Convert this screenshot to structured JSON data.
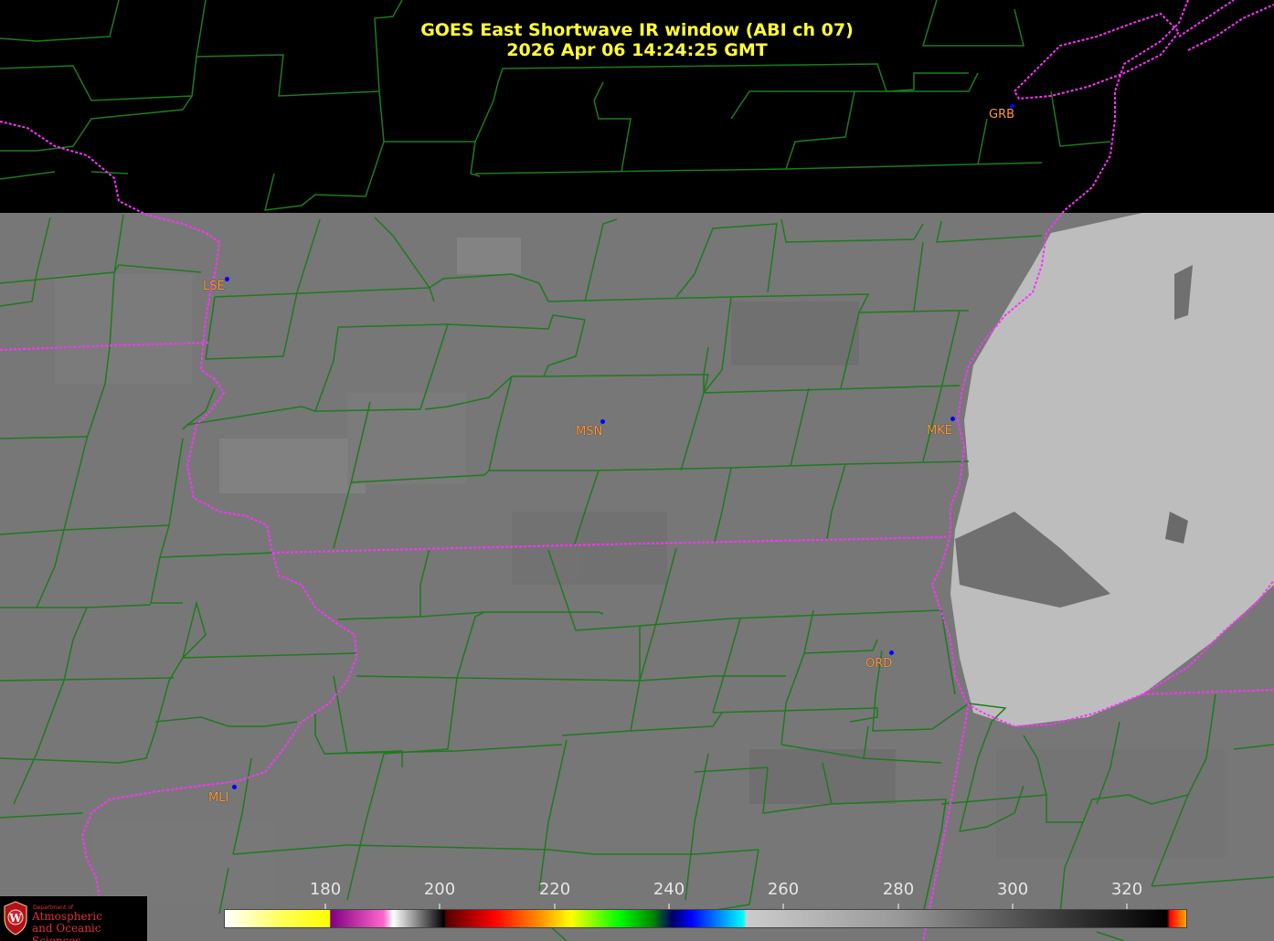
{
  "title": {
    "line1": "GOES East Shortwave IR window (ABI ch 07)",
    "line2": "2026 Apr 06  14:24:25 GMT"
  },
  "stations": [
    {
      "id": "GRB"
    },
    {
      "id": "LSE"
    },
    {
      "id": "MSN"
    },
    {
      "id": "MKE"
    },
    {
      "id": "ORD"
    },
    {
      "id": "MLI"
    }
  ],
  "colorbar": {
    "ticks": [
      "180",
      "200",
      "220",
      "240",
      "260",
      "280",
      "300",
      "320"
    ]
  },
  "logo": {
    "small_text": "Department of",
    "line1": "Atmospheric",
    "line2": "and Oceanic Sciences",
    "icon": "university-crest-icon"
  },
  "colors": {
    "title": "#ffff33",
    "county_lines": "#1f7a1f",
    "state_boundary": "#ff33ff",
    "station_label": "#ff9a3a",
    "station_dot": "#0000ff"
  }
}
